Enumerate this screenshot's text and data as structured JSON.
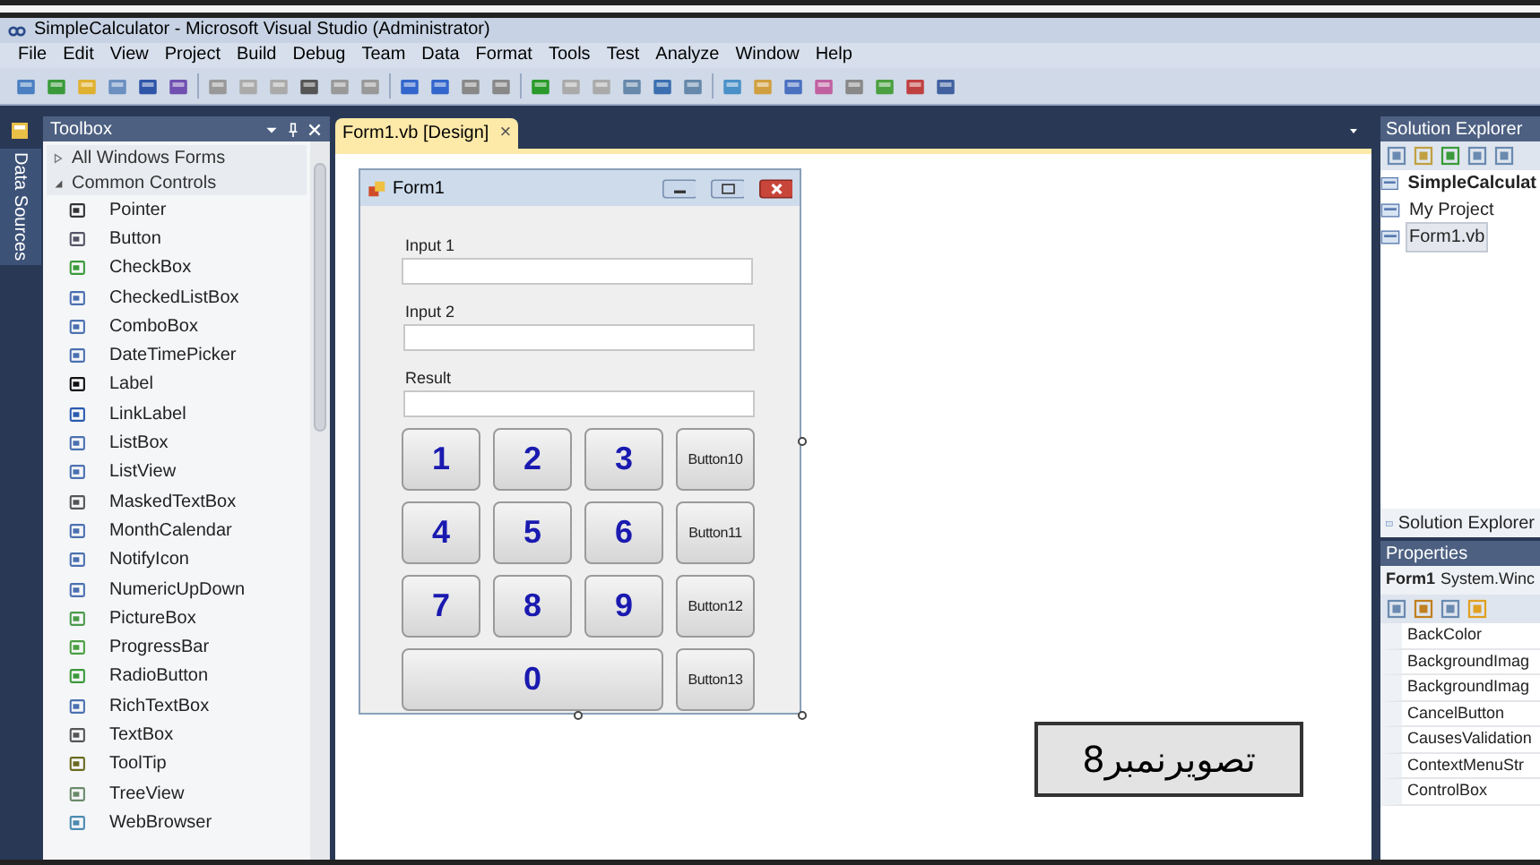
{
  "window": {
    "title": "SimpleCalculator - Microsoft Visual Studio (Administrator)"
  },
  "menu": [
    "File",
    "Edit",
    "View",
    "Project",
    "Build",
    "Debug",
    "Team",
    "Data",
    "Format",
    "Tools",
    "Test",
    "Analyze",
    "Window",
    "Help"
  ],
  "side_strip": {
    "label": "Data Sources"
  },
  "toolbox": {
    "title": "Toolbox",
    "sections": [
      {
        "label": "All Windows Forms",
        "expanded": false
      },
      {
        "label": "Common Controls",
        "expanded": true
      }
    ],
    "items": [
      "Pointer",
      "Button",
      "CheckBox",
      "CheckedListBox",
      "ComboBox",
      "DateTimePicker",
      "Label",
      "LinkLabel",
      "ListBox",
      "ListView",
      "MaskedTextBox",
      "MonthCalendar",
      "NotifyIcon",
      "NumericUpDown",
      "PictureBox",
      "ProgressBar",
      "RadioButton",
      "RichTextBox",
      "TextBox",
      "ToolTip",
      "TreeView",
      "WebBrowser"
    ]
  },
  "document_tab": {
    "label": "Form1.vb [Design]",
    "close": "×"
  },
  "form": {
    "title": "Form1",
    "fields": [
      {
        "label": "Input 1"
      },
      {
        "label": "Input 2"
      },
      {
        "label": "Result"
      }
    ],
    "buttons": [
      {
        "label": "1",
        "kind": "digit"
      },
      {
        "label": "2",
        "kind": "digit"
      },
      {
        "label": "3",
        "kind": "digit"
      },
      {
        "label": "Button10",
        "kind": "named"
      },
      {
        "label": "4",
        "kind": "digit"
      },
      {
        "label": "5",
        "kind": "digit"
      },
      {
        "label": "6",
        "kind": "digit"
      },
      {
        "label": "Button11",
        "kind": "named"
      },
      {
        "label": "7",
        "kind": "digit"
      },
      {
        "label": "8",
        "kind": "digit"
      },
      {
        "label": "9",
        "kind": "digit"
      },
      {
        "label": "Button12",
        "kind": "named"
      },
      {
        "label": "0",
        "kind": "wide"
      },
      {
        "label": "Button13",
        "kind": "named"
      }
    ]
  },
  "solution_explorer": {
    "title": "Solution Explorer",
    "tree": [
      {
        "label": "SimpleCalculat",
        "selected": false,
        "children": [
          {
            "label": "My Project",
            "selected": false
          },
          {
            "label": "Form1.vb",
            "selected": true
          }
        ]
      }
    ],
    "footer_tab": "Solution Explorer"
  },
  "properties": {
    "title": "Properties",
    "object": "Form1",
    "type": "System.Winc",
    "rows": [
      "BackColor",
      "BackgroundImag",
      "BackgroundImag",
      "CancelButton",
      "CausesValidation",
      "ContextMenuStr",
      "ControlBox"
    ]
  },
  "caption": "تصویرنمبر8"
}
